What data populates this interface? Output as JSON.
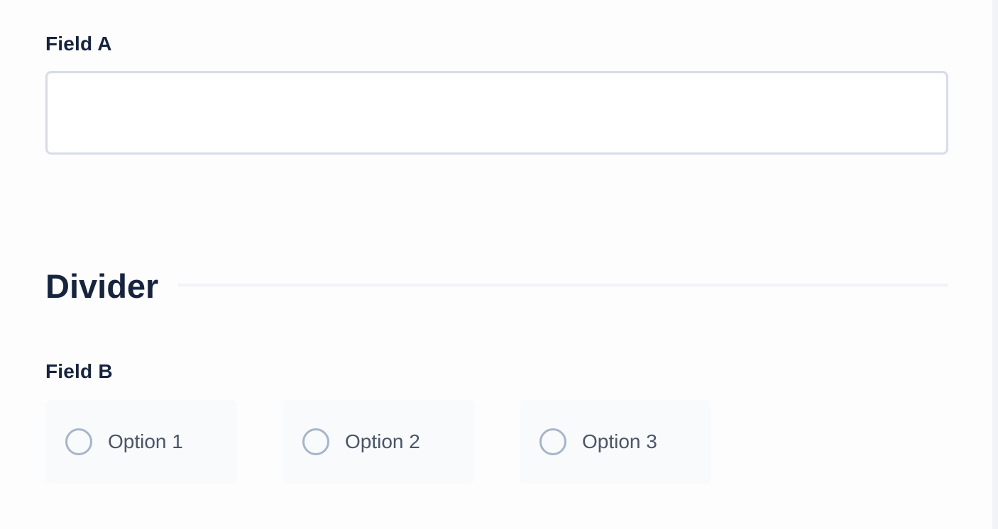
{
  "form": {
    "field_a": {
      "label": "Field A",
      "value": "",
      "placeholder": ""
    },
    "divider": {
      "title": "Divider"
    },
    "field_b": {
      "label": "Field B",
      "options": [
        {
          "label": "Option 1",
          "selected": false
        },
        {
          "label": "Option 2",
          "selected": false
        },
        {
          "label": "Option 3",
          "selected": false
        }
      ]
    }
  },
  "colors": {
    "background": "#fdfdfe",
    "text_primary": "#16243d",
    "text_secondary": "#4a5568",
    "input_border": "#d8dce8",
    "option_background": "#f8fafc",
    "radio_border": "#a6b5c8",
    "divider_line": "#f1f3f6"
  },
  "icons": {
    "radio": "radio-unchecked-icon"
  }
}
